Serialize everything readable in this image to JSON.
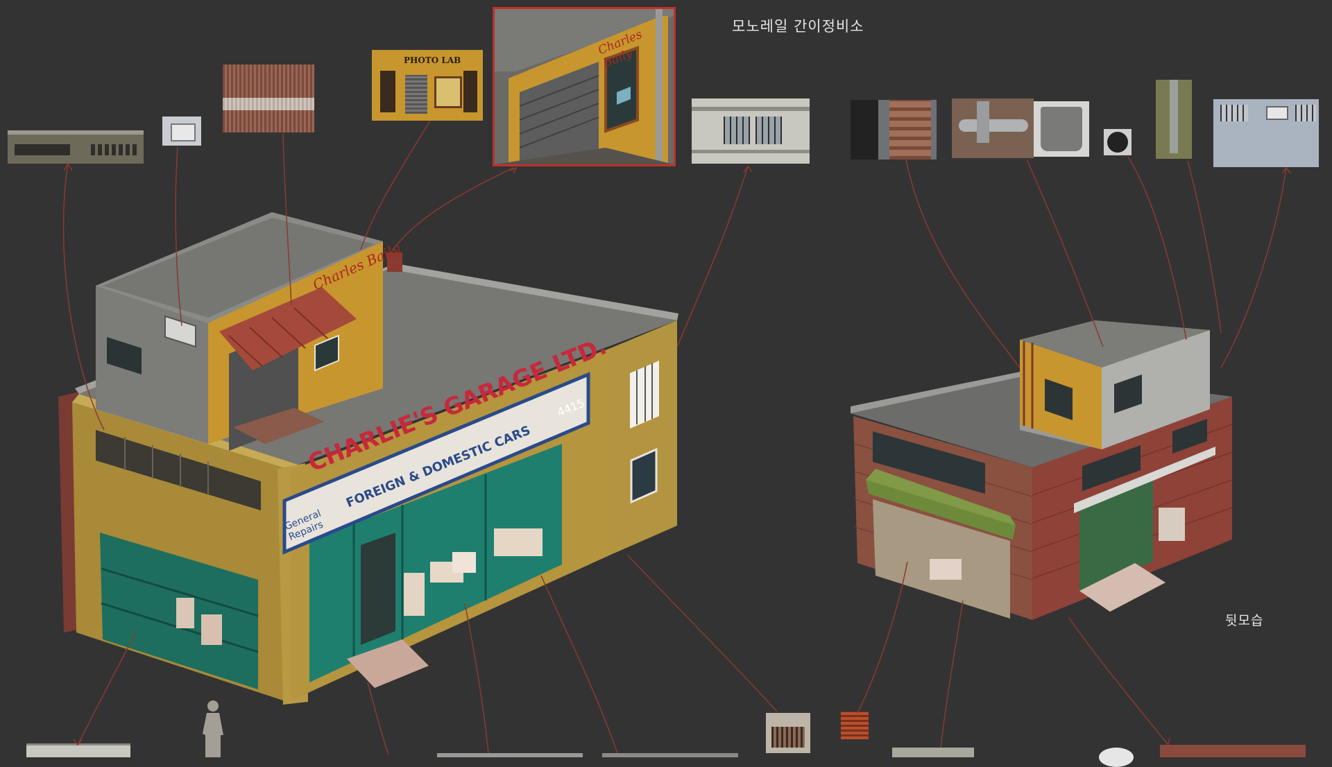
{
  "labels": {
    "title": "모노레일 간이정비소",
    "back_view": "뒷모습"
  },
  "signage": {
    "main_sign_line1": "CHARLIE'S GARAGE LTD.",
    "main_sign_line2": "FOREIGN & DOMESTIC CARS",
    "main_sign_side": "General Repairs",
    "main_sign_number": "4415",
    "rooftop_sign": "Charles Baily",
    "photo_lab": "PHOTO LAB"
  },
  "colors": {
    "background": "#333333",
    "leader_line": "#8a3a30",
    "highlight_border": "#c0302a",
    "garage_green": "#1f7f6f",
    "wall_yellow": "#b8983c",
    "brick_red": "#8a3b33",
    "concrete": "#8a8a86"
  }
}
